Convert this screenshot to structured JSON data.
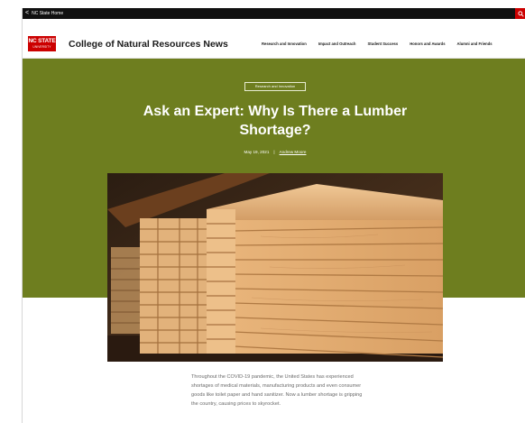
{
  "topbar": {
    "back_glyph": "<",
    "home_label": "NC State Home",
    "search_icon": "search-icon"
  },
  "header": {
    "logo_line1": "NC STATE",
    "logo_line2": "UNIVERSITY",
    "site_title": "College of Natural Resources News",
    "nav": [
      "Research and Innovation",
      "Impact and Outreach",
      "Student Success",
      "Honors and Awards",
      "Alumni and Friends"
    ]
  },
  "article": {
    "tag": "Research and Innovation",
    "headline": "Ask an Expert: Why Is There a Lumber Shortage?",
    "date": "May 19, 2021",
    "separator": "|",
    "author": "Andrew Moore",
    "body": "Throughout the COVID-19 pandemic, the United States has experienced shortages of medical materials, manufacturing products and even consumer goods like toilet paper and hand sanitizer. Now a lumber shortage is gripping the country, causing prices to skyrocket."
  },
  "colors": {
    "hero_green": "#6e7e1f",
    "brand_red": "#cc0000",
    "topbar": "#111111"
  }
}
